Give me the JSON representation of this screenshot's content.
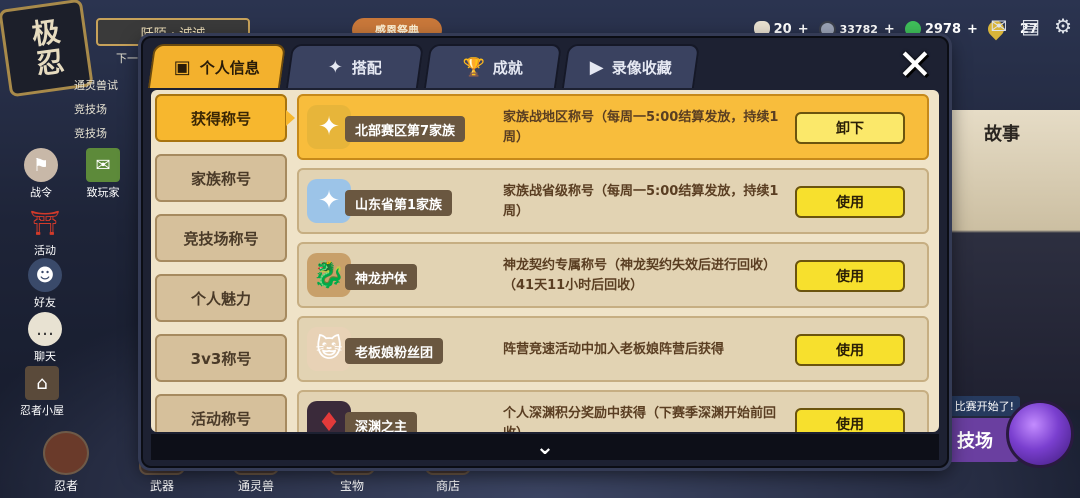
{
  "background": {
    "logo_text": "极忍",
    "player_name": "阡陌 · 诚诚",
    "event_label": "感恩祭典",
    "quest_next": "下一",
    "quests": [
      "通灵兽试",
      "竞技场",
      "竞技场"
    ],
    "currencies": [
      {
        "value": "20",
        "color": "#e8e0d0",
        "icon": "rice-ball-icon"
      },
      {
        "value": "33782",
        "color": "#9aa3b5",
        "icon": "coin-icon"
      },
      {
        "value": "2978",
        "color": "#3fbf5a",
        "icon": "jade-icon"
      },
      {
        "value": "27",
        "color": "#d8b43a",
        "icon": "medal-icon"
      }
    ],
    "top_icons": [
      "mail-icon",
      "shop-icon",
      "settings-icon"
    ],
    "side_menu": [
      {
        "label": "战令",
        "icon": "battle-pass-icon"
      },
      {
        "label": "致玩家",
        "icon": "letter-icon"
      },
      {
        "label": "活动",
        "icon": "torii-gate-icon"
      },
      {
        "label": "好友",
        "icon": "friend-icon"
      },
      {
        "label": "聊天",
        "icon": "chat-icon"
      },
      {
        "label": "忍者小屋",
        "icon": "house-icon"
      }
    ],
    "bottom_nav": [
      {
        "label": "忍者"
      },
      {
        "label": "武器"
      },
      {
        "label": "通灵兽"
      },
      {
        "label": "宝物"
      },
      {
        "label": "商店"
      }
    ],
    "story_label": "故事",
    "match_banner": "比赛开始了!",
    "arena_label": "技场"
  },
  "modal": {
    "tabs": [
      {
        "label": "个人信息",
        "icon": "profile-icon",
        "active": true
      },
      {
        "label": "搭配",
        "icon": "shuriken-icon",
        "active": false
      },
      {
        "label": "成就",
        "icon": "trophy-icon",
        "active": false
      },
      {
        "label": "录像收藏",
        "icon": "play-icon",
        "active": false
      }
    ],
    "close_icon": "close-icon",
    "categories": [
      {
        "label": "获得称号",
        "active": true
      },
      {
        "label": "家族称号",
        "active": false
      },
      {
        "label": "竞技场称号",
        "active": false
      },
      {
        "label": "个人魅力",
        "active": false
      },
      {
        "label": "3v3称号",
        "active": false
      },
      {
        "label": "活动称号",
        "active": false
      }
    ],
    "titles": [
      {
        "name": "北部赛区第7家族",
        "desc": "家族战地区称号（每周一5:00结算发放，持续1周）",
        "action": "卸下",
        "active": true,
        "emblem": "gold-star-emblem-icon",
        "emblem_color": "#e7b53a"
      },
      {
        "name": "山东省第1家族",
        "desc": "家族战省级称号（每周一5:00结算发放，持续1周）",
        "action": "使用",
        "active": false,
        "emblem": "silver-star-emblem-icon",
        "emblem_color": "#9cc4e8"
      },
      {
        "name": "神龙护体",
        "desc": "神龙契约专属称号（神龙契约失效后进行回收）（41天11小时后回收）",
        "action": "使用",
        "active": false,
        "emblem": "dragon-emblem-icon",
        "emblem_color": "#c8a06a"
      },
      {
        "name": "老板娘粉丝团",
        "desc": "阵营竞速活动中加入老板娘阵营后获得",
        "action": "使用",
        "active": false,
        "emblem": "cat-girl-emblem-icon",
        "emblem_color": "#e8d2b6"
      },
      {
        "name": "深渊之主",
        "desc": "个人深渊积分奖励中获得（下赛季深渊开始前回收）",
        "action": "使用",
        "active": false,
        "emblem": "abyss-emblem-icon",
        "emblem_color": "#3a2a3a"
      }
    ],
    "scroll_icon": "chevron-down-icon"
  }
}
